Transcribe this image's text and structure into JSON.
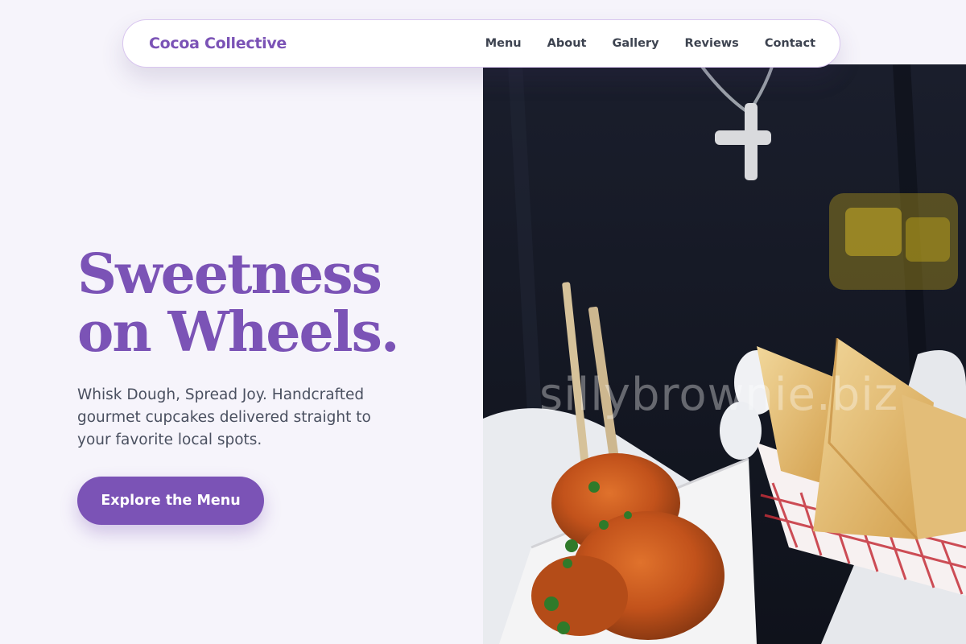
{
  "colors": {
    "accent": "#7b53b6",
    "background": "#f6f4fb",
    "text_muted": "#4a5060",
    "nav_text": "#3d4350"
  },
  "header": {
    "brand": "Cocoa Collective",
    "nav": [
      {
        "label": "Menu"
      },
      {
        "label": "About"
      },
      {
        "label": "Gallery"
      },
      {
        "label": "Reviews"
      },
      {
        "label": "Contact"
      }
    ]
  },
  "hero": {
    "title_line1": "Sweetness",
    "title_line2": "on Wheels.",
    "subtitle": "Whisk Dough, Spread Joy. Handcrafted gourmet cupcakes delivered straight to your favorite local spots.",
    "cta_label": "Explore the Menu",
    "watermark": "sillybrownie.biz"
  }
}
